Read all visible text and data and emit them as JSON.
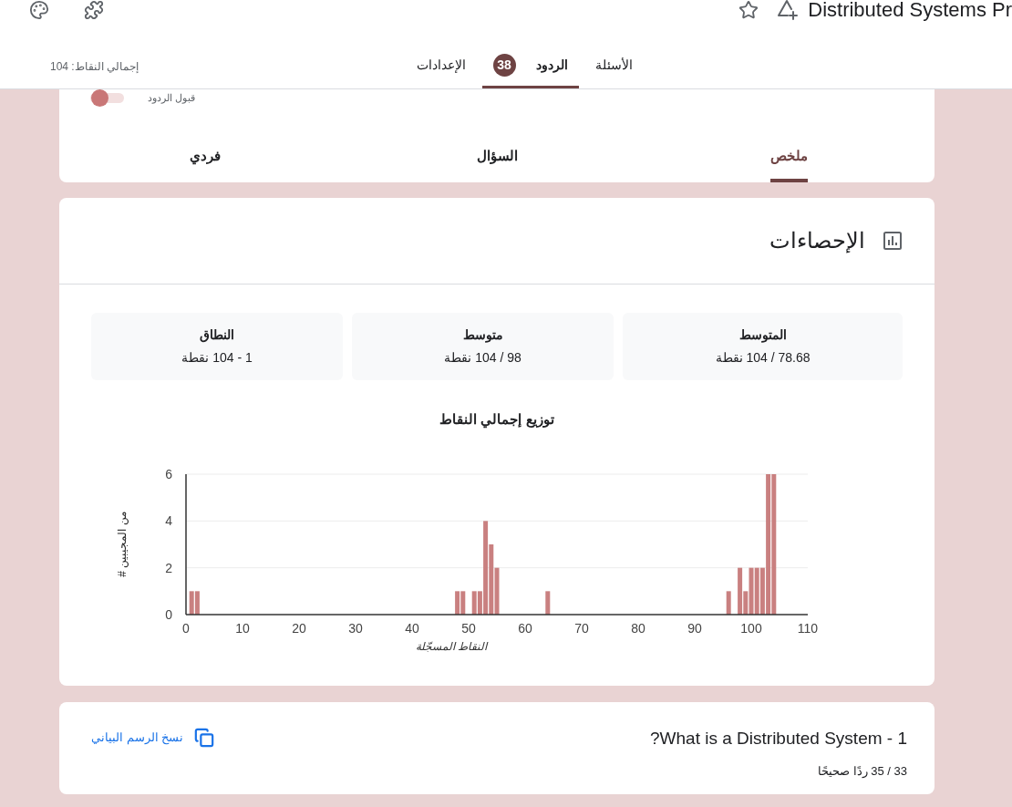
{
  "header": {
    "title": "Distributed Systems Pr",
    "tabs": [
      {
        "label": "الأسئلة",
        "selected": false
      },
      {
        "label": "الردود",
        "badge": "38",
        "selected": true
      },
      {
        "label": "الإعدادات",
        "selected": false
      }
    ],
    "total_points": "إجمالي النقاط: 104"
  },
  "responses_card": {
    "accepting": {
      "label": "قبول الردود",
      "on": true
    },
    "tabs": [
      {
        "label": "ملخص",
        "selected": true
      },
      {
        "label": "السؤال",
        "selected": false
      },
      {
        "label": "فردي",
        "selected": false
      }
    ]
  },
  "statistics": {
    "title": "الإحصاءات",
    "stats": [
      {
        "label": "المتوسط",
        "value": "78.68 / 104 نقطة"
      },
      {
        "label": "متوسط",
        "value": "98 / 104 نقطة"
      },
      {
        "label": "النطاق",
        "value": "1 - 104 نقطة"
      }
    ],
    "chart_data": {
      "type": "bar",
      "title": "توزيع إجمالي النقاط",
      "xlabel": "النقاط المسجّلة",
      "ylabel": "# من المجيبين",
      "x": [
        1,
        2,
        48,
        49,
        51,
        52,
        53,
        54,
        55,
        64,
        96,
        98,
        99,
        100,
        101,
        102,
        103,
        104
      ],
      "values": [
        1,
        1,
        1,
        1,
        1,
        1,
        4,
        3,
        2,
        1,
        1,
        2,
        1,
        2,
        2,
        2,
        6,
        6
      ],
      "xlim": [
        0,
        110
      ],
      "ylim": [
        0,
        6
      ],
      "xticks": [
        0,
        10,
        20,
        30,
        40,
        50,
        60,
        70,
        80,
        90,
        100,
        110
      ],
      "yticks": [
        0,
        2,
        4,
        6
      ]
    }
  },
  "questions": [
    {
      "title": "1 - What is a Distributed System?",
      "score": "33 / 35 ردًا صحيحًا",
      "copy_label": "نسخ الرسم البياني"
    }
  ]
}
